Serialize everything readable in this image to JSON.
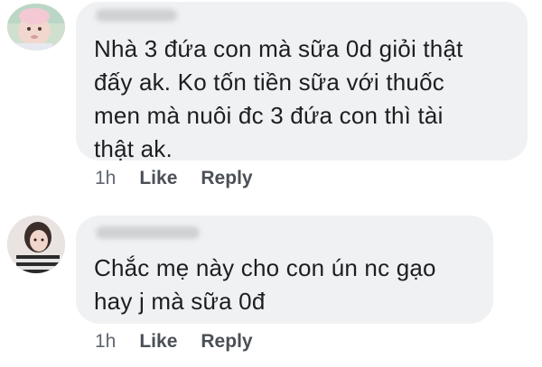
{
  "comments": [
    {
      "text": "Nhà 3 đứa con mà sữa 0d giỏi thật\nđấy ak. Ko tốn tiền sữa với thuốc\nmen mà nuôi đc 3 đứa con thì tài\nthật ak.",
      "time": "1h",
      "like_label": "Like",
      "reply_label": "Reply"
    },
    {
      "text": "Chắc mẹ này cho con ún nc gạo\nhay j mà sữa 0đ",
      "time": "1h",
      "like_label": "Like",
      "reply_label": "Reply"
    }
  ],
  "colors": {
    "bubble": "#f0f1f3",
    "text": "#1c1e21",
    "action": "#4b4f56"
  }
}
